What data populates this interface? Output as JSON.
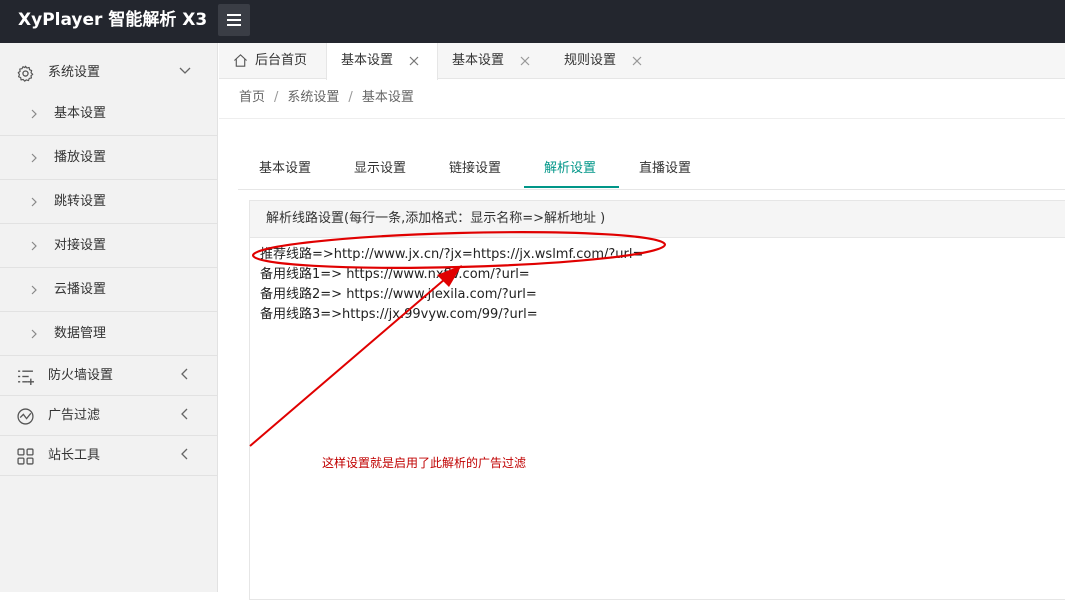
{
  "app": {
    "title": "XyPlayer 智能解析 X3"
  },
  "sidebar": {
    "groups": [
      {
        "label": "系统设置",
        "icon": "gear-icon",
        "expanded": true
      },
      {
        "label": "防火墙设置",
        "icon": "list-icon"
      },
      {
        "label": "广告过滤",
        "icon": "chart-icon"
      },
      {
        "label": "站长工具",
        "icon": "grid-icon"
      }
    ],
    "subitems": [
      "基本设置",
      "播放设置",
      "跳转设置",
      "对接设置",
      "云播设置",
      "数据管理"
    ]
  },
  "tabs": [
    {
      "label": "后台首页",
      "icon": "home-icon"
    },
    {
      "label": "基本设置",
      "active": true
    },
    {
      "label": "基本设置"
    },
    {
      "label": "规则设置"
    }
  ],
  "breadcrumb": [
    "首页",
    "系统设置",
    "基本设置"
  ],
  "subtabs": [
    "基本设置",
    "显示设置",
    "链接设置",
    "解析设置",
    "直播设置"
  ],
  "subtabs_active": "解析设置",
  "panel": {
    "title": "解析线路设置(每行一条,添加格式：显示名称=>解析地址 )",
    "lines": [
      "推荐线路=>http://www.jx.cn/?jx=https://jx.wslmf.com/?url=",
      "备用线路1=> https://www.nxflv.com/?url=",
      "备用线路2=> https://www.jiexila.com/?url=",
      "备用线路3=>https://jx.99vyw.com/99/?url="
    ]
  },
  "annotation": {
    "text": "这样设置就是启用了此解析的广告过滤",
    "color": "#e00000"
  },
  "colors": {
    "accent": "#009688",
    "topbar": "#23262e"
  }
}
